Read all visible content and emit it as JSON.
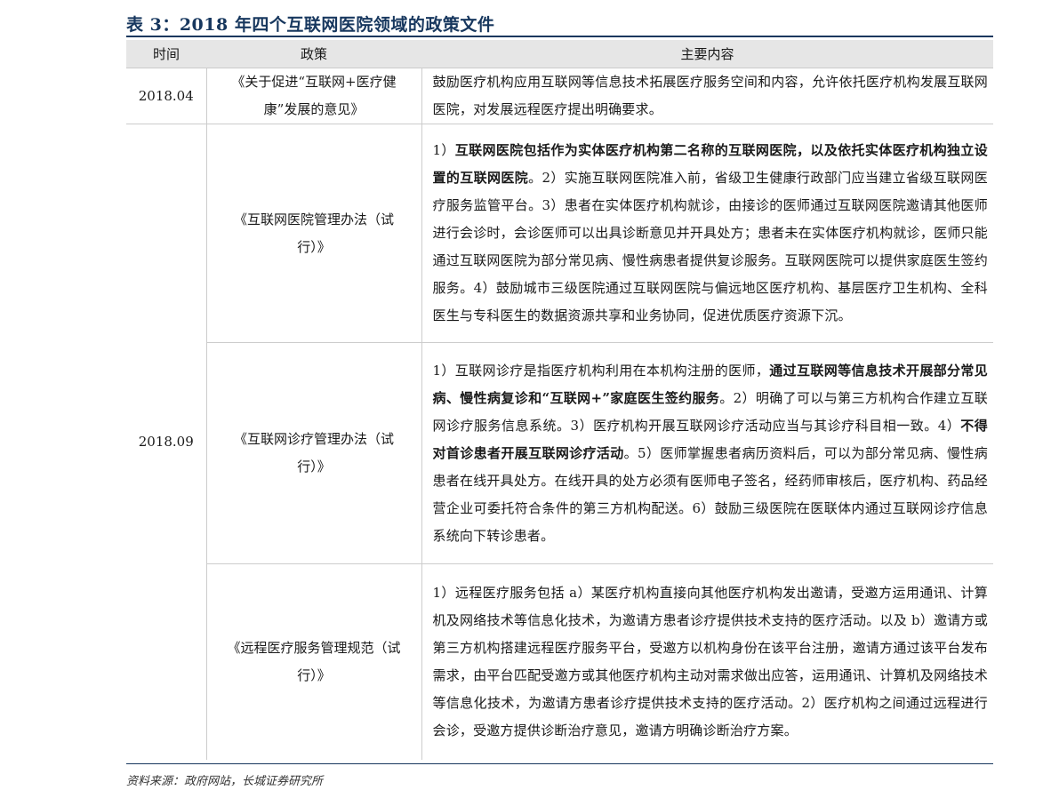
{
  "title": "表 3：2018 年四个互联网医院领域的政策文件",
  "table": {
    "headers": [
      "时间",
      "政策",
      "主要内容"
    ],
    "rows": [
      {
        "time": "2018.04",
        "policy": "《关于促进“互联网+医疗健康”发展的意见》",
        "content": [
          {
            "text": "鼓励医疗机构应用互联网等信息技术拓展医疗服务空间和内容，允许依托医疗机构发展互联网医院，对发展远程医疗提出明确要求。",
            "bold": false
          }
        ]
      },
      {
        "time": "2018.09",
        "policy": "《互联网医院管理办法（试行）》",
        "content": [
          {
            "text": "1）",
            "bold": false
          },
          {
            "text": "互联网医院包括作为实体医疗机构第二名称的互联网医院，以及依托实体医疗机构独立设置的互联网医院",
            "bold": true
          },
          {
            "text": "。2）实施互联网医院准入前，省级卫生健康行政部门应当建立省级互联网医疗服务监管平台。3）患者在实体医疗机构就诊，由接诊的医师通过互联网医院邀请其他医师进行会诊时，会诊医师可以出具诊断意见并开具处方；患者未在实体医疗机构就诊，医师只能通过互联网医院为部分常见病、慢性病患者提供复诊服务。互联网医院可以提供家庭医生签约服务。4）鼓励城市三级医院通过互联网医院与偏远地区医疗机构、基层医疗卫生机构、全科医生与专科医生的数据资源共享和业务协同，促进优质医疗资源下沉。",
            "bold": false
          }
        ]
      },
      {
        "time": "",
        "policy": "《互联网诊疗管理办法（试行）》",
        "content": [
          {
            "text": "1）互联网诊疗是指医疗机构利用在本机构注册的医师，",
            "bold": false
          },
          {
            "text": "通过互联网等信息技术开展部分常见病、慢性病复诊和“互联网+”家庭医生签约服务",
            "bold": true
          },
          {
            "text": "。2）明确了可以与第三方机构合作建立互联网诊疗服务信息系统。3）医疗机构开展互联网诊疗活动应当与其诊疗科目相一致。4）",
            "bold": false
          },
          {
            "text": "不得对首诊患者开展互联网诊疗活动",
            "bold": true
          },
          {
            "text": "。5）医师掌握患者病历资料后，可以为部分常见病、慢性病患者在线开具处方。在线开具的处方必须有医师电子签名，经药师审核后，医疗机构、药品经营企业可委托符合条件的第三方机构配送。6）鼓励三级医院在医联体内通过互联网诊疗信息系统向下转诊患者。",
            "bold": false
          }
        ]
      },
      {
        "time": "",
        "policy": "《远程医疗服务管理规范（试行）》",
        "content": [
          {
            "text": "1）远程医疗服务包括 a）某医疗机构直接向其他医疗机构发出邀请，受邀方运用通讯、计算机及网络技术等信息化技术，为邀请方患者诊疗提供技术支持的医疗活动。以及 b）邀请方或第三方机构搭建远程医疗服务平台，受邀方以机构身份在该平台注册，邀请方通过该平台发布需求，由平台匹配受邀方或其他医疗机构主动对需求做出应答，运用通讯、计算机及网络技术等信息化技术，为邀请方患者诊疗提供技术支持的医疗活动。2）医疗机构之间通过远程进行会诊，受邀方提供诊断治疗意见，邀请方明确诊断治疗方案。",
            "bold": false
          }
        ]
      }
    ]
  },
  "source": "资料来源：政府网站，长城证券研究所"
}
